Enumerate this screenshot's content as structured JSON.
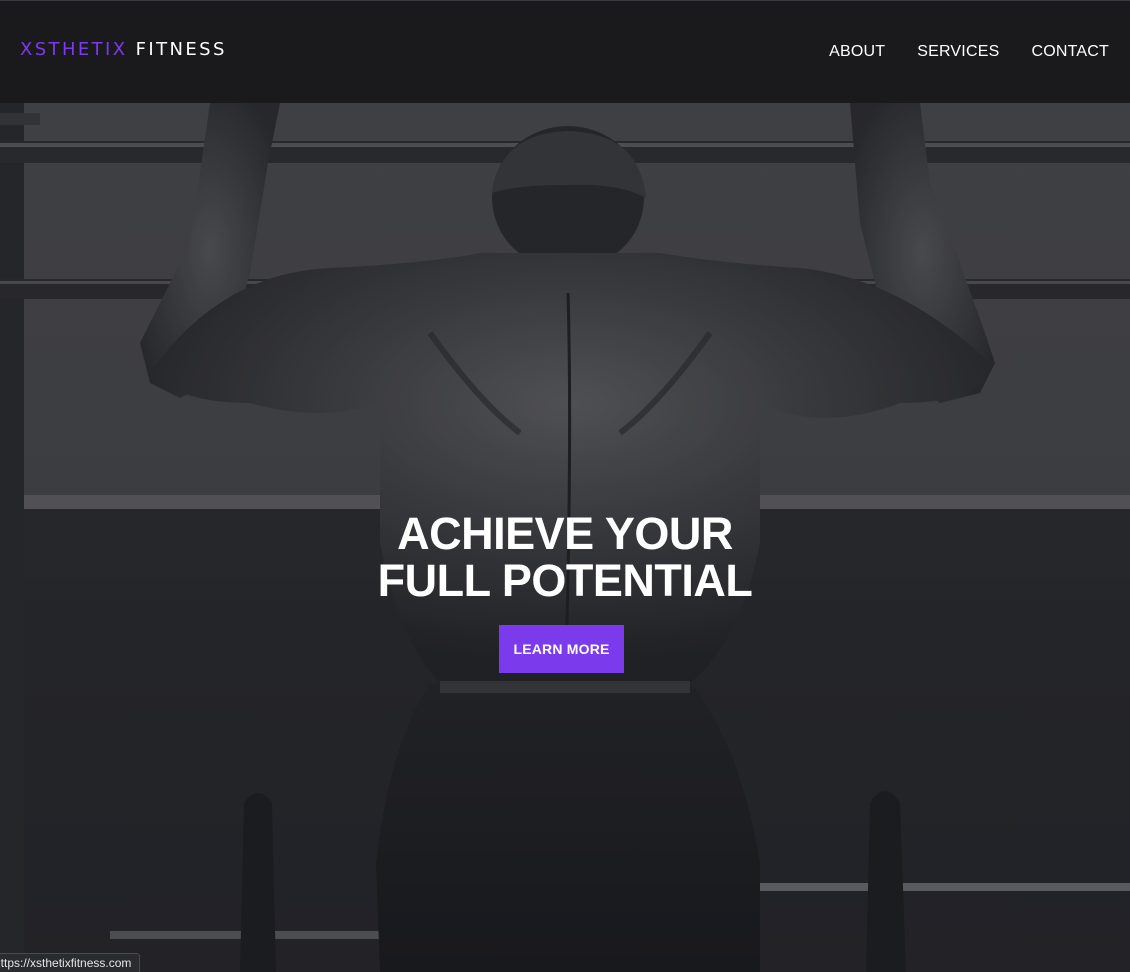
{
  "brand": {
    "logo_accent": "XSTHETIX",
    "logo_rest": "FITNESS",
    "accent_color": "#7c3aed"
  },
  "nav": {
    "items": [
      {
        "label": "ABOUT"
      },
      {
        "label": "SERVICES"
      },
      {
        "label": "CONTACT"
      }
    ]
  },
  "hero": {
    "headline_line1": "ACHIEVE YOUR",
    "headline_line2": "FULL POTENTIAL",
    "cta_label": "LEARN MORE"
  },
  "status_bar": {
    "url": "https://xsthetixfitness.com"
  }
}
